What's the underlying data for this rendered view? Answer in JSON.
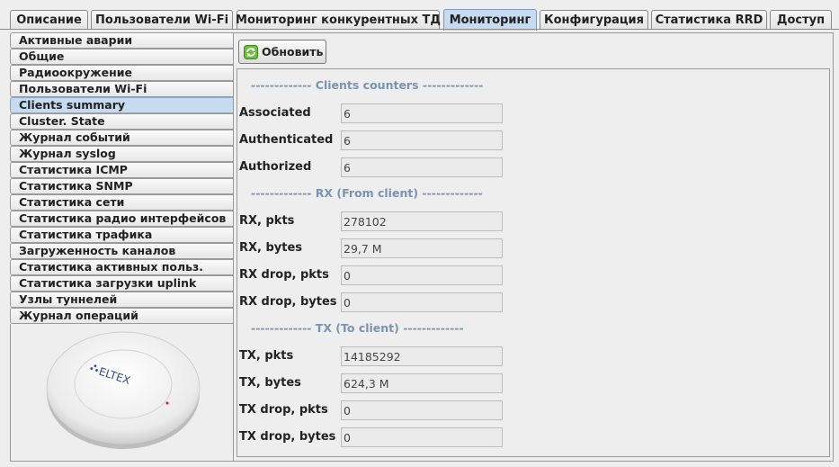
{
  "tabs": [
    {
      "label": "Описание"
    },
    {
      "label": "Пользователи Wi-Fi"
    },
    {
      "label": "Мониторинг конкурентных ТД"
    },
    {
      "label": "Мониторинг"
    },
    {
      "label": "Конфигурация"
    },
    {
      "label": "Статистика RRD"
    },
    {
      "label": "Доступ"
    }
  ],
  "active_tab": "Мониторинг",
  "sidebar": {
    "items": [
      {
        "label": "Активные аварии"
      },
      {
        "label": "Общие"
      },
      {
        "label": "Радиоокружение"
      },
      {
        "label": "Пользователи Wi-Fi"
      },
      {
        "label": "Clients summary"
      },
      {
        "label": "Cluster. State"
      },
      {
        "label": "Журнал событий"
      },
      {
        "label": "Журнал syslog"
      },
      {
        "label": "Статистика ICMP"
      },
      {
        "label": "Статистика SNMP"
      },
      {
        "label": "Статистика сети"
      },
      {
        "label": "Статистика радио интерфейсов"
      },
      {
        "label": "Статистика трафика"
      },
      {
        "label": "Загруженность каналов"
      },
      {
        "label": "Статистика активных польз."
      },
      {
        "label": "Статистика загрузки uplink"
      },
      {
        "label": "Узлы туннелей"
      },
      {
        "label": "Журнал операций"
      }
    ],
    "active": "Clients summary",
    "device_logo": "ELTEX"
  },
  "toolbar": {
    "refresh_label": "Обновить",
    "refresh_icon": "refresh-icon"
  },
  "sections": {
    "clients_title": "------------- Clients counters -------------",
    "rx_title": "------------- RX (From client) -------------",
    "tx_title": "------------- TX (To client) -------------"
  },
  "fields": {
    "associated": {
      "label": "Associated",
      "value": "6"
    },
    "authenticated": {
      "label": "Authenticated",
      "value": "6"
    },
    "authorized": {
      "label": "Authorized",
      "value": "6"
    },
    "rx_pkts": {
      "label": "RX, pkts",
      "value": "278102"
    },
    "rx_bytes": {
      "label": "RX, bytes",
      "value": "29,7 M"
    },
    "rx_drop_pkts": {
      "label": "RX drop, pkts",
      "value": "0"
    },
    "rx_drop_bytes": {
      "label": "RX drop, bytes",
      "value": "0"
    },
    "tx_pkts": {
      "label": "TX, pkts",
      "value": "14185292"
    },
    "tx_bytes": {
      "label": "TX, bytes",
      "value": "624,3 M"
    },
    "tx_drop_pkts": {
      "label": "TX drop, pkts",
      "value": "0"
    },
    "tx_drop_bytes": {
      "label": "TX drop, bytes",
      "value": "0"
    }
  },
  "colors": {
    "accent": "#c6dbf0",
    "section_title": "#7b93b0"
  }
}
